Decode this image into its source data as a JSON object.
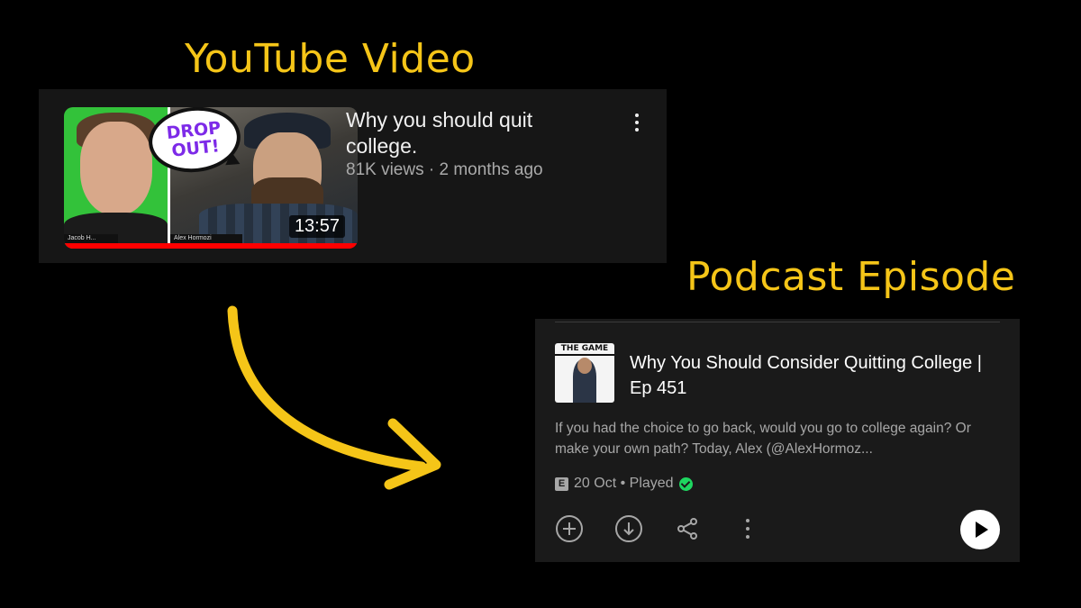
{
  "youtube": {
    "heading": "YouTube Video",
    "title": "Why you should quit college.",
    "meta": "81K views · 2 months ago",
    "duration": "13:57",
    "thumbnail_text": "DROP\nOUT!",
    "name_left": "Jacob H...",
    "name_right": "Alex Hormozi",
    "watch_progress": 1.0,
    "accent": "#ff0000"
  },
  "podcast": {
    "heading": "Podcast Episode",
    "art_title": "THE GAME",
    "title": "Why You Should Consider Quitting College | Ep 451",
    "description": "If you had the choice to go back, would you go to college again? Or make your own path? Today, Alex (@AlexHormoz...",
    "explicit_badge": "E",
    "date": "20 Oct",
    "separator": " • ",
    "status": "Played",
    "played_color": "#1ed760",
    "actions": [
      "add-icon",
      "download-icon",
      "share-icon",
      "more-icon",
      "play-icon"
    ]
  },
  "colors": {
    "heading": "#f5c518",
    "arrow": "#f5c518",
    "background": "#000000"
  }
}
